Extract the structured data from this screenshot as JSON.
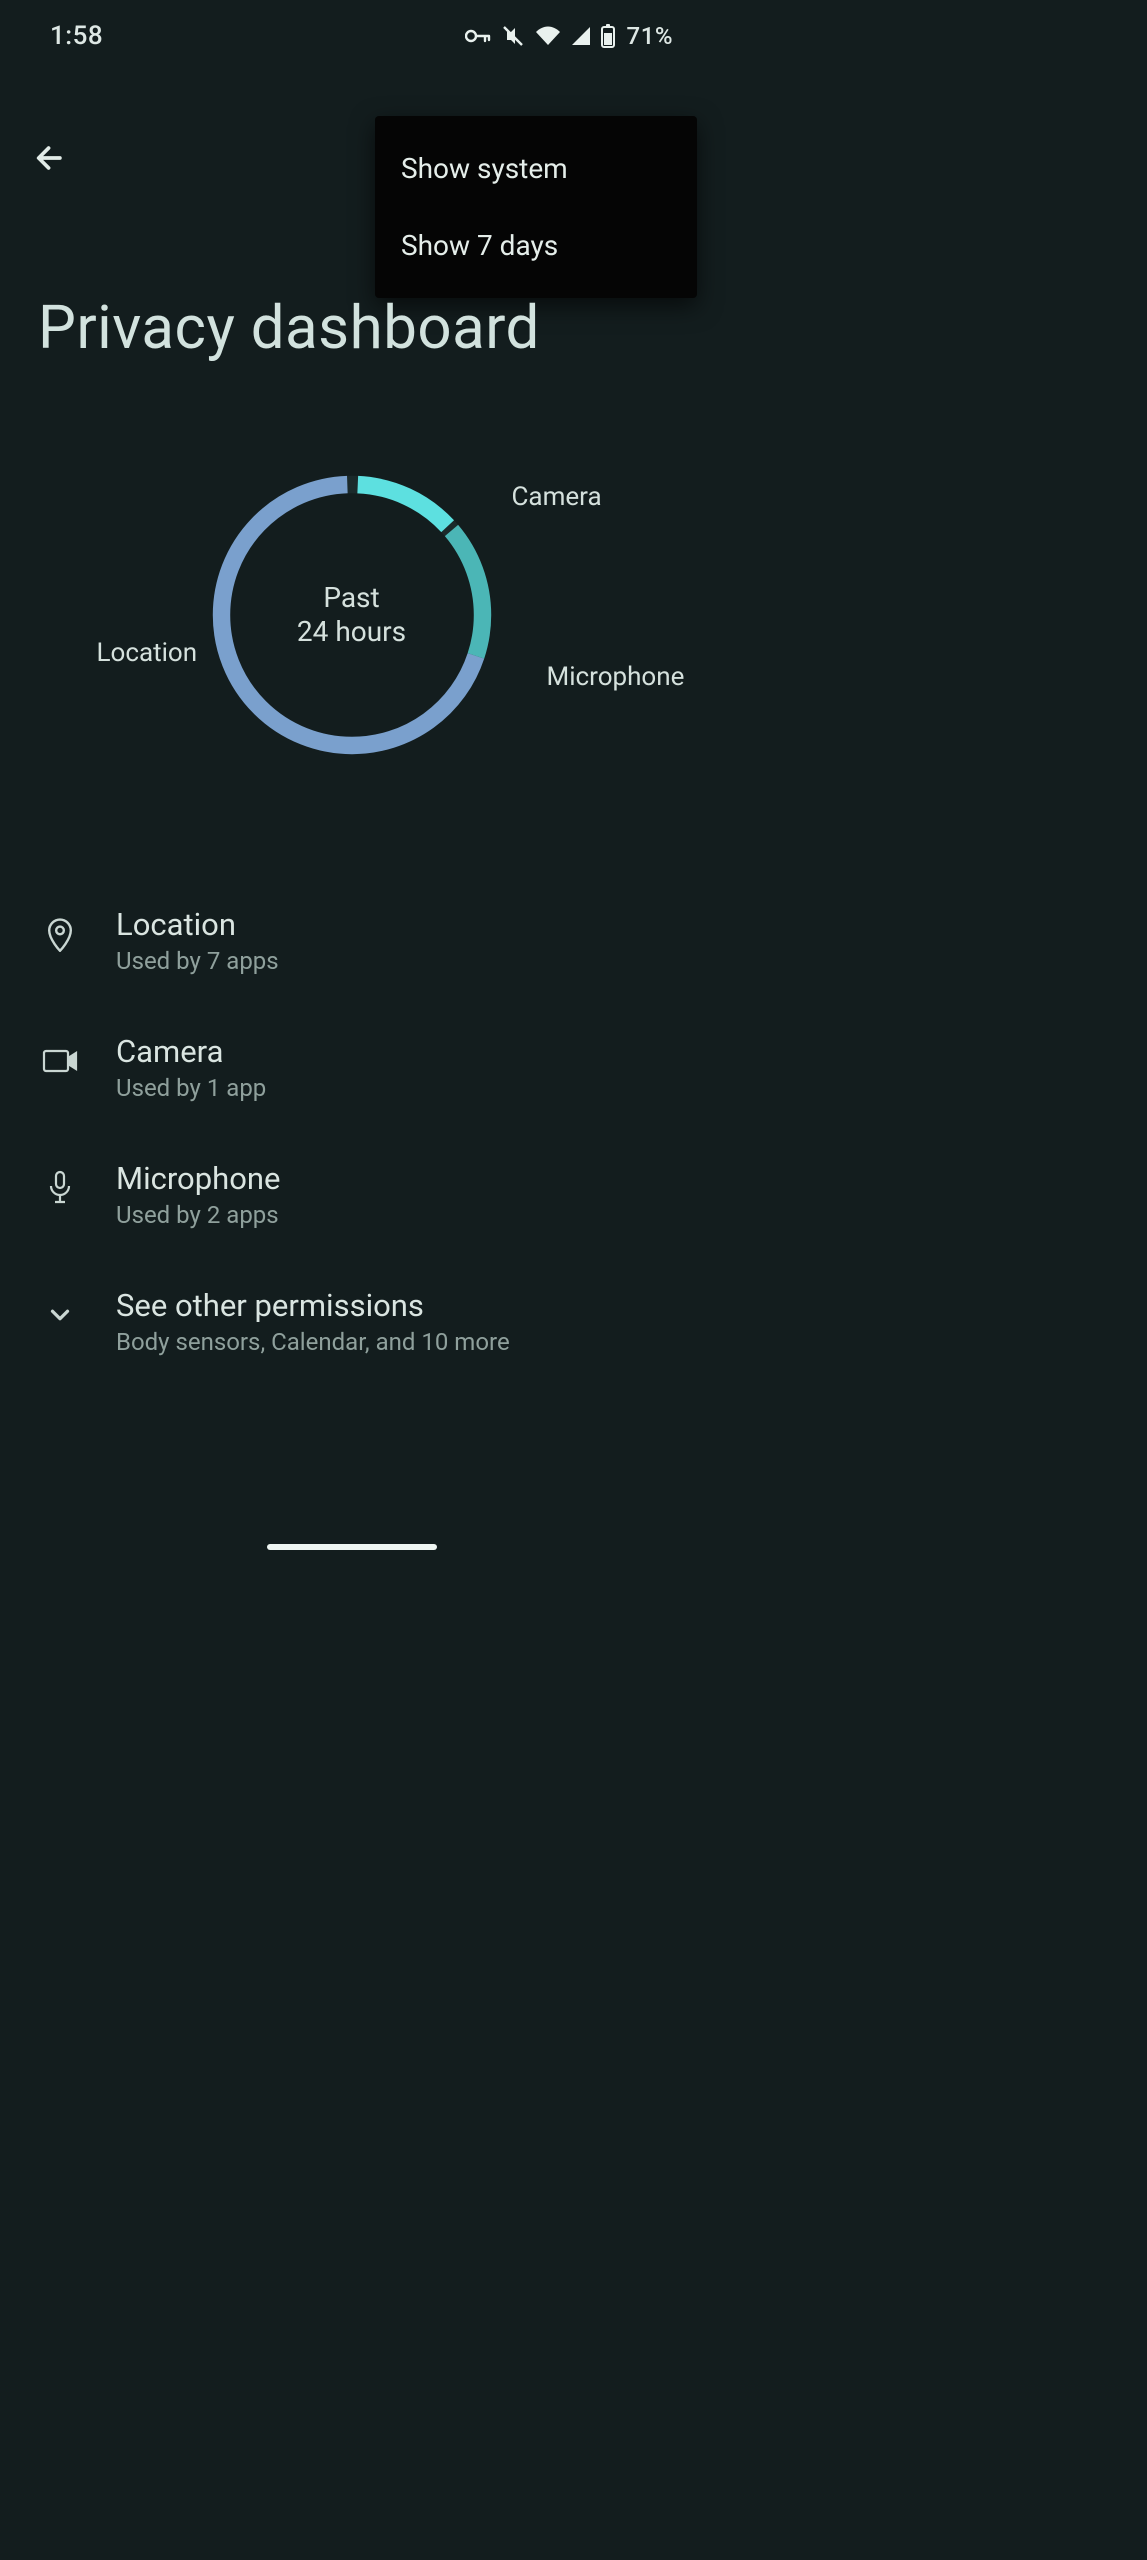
{
  "status": {
    "time": "1:58",
    "battery": "71%"
  },
  "menu": {
    "item1": "Show system",
    "item2": "Show 7 days"
  },
  "title": "Privacy dashboard",
  "chart": {
    "center1": "Past",
    "center2": "24 hours",
    "labels": {
      "camera": "Camera",
      "microphone": "Microphone",
      "location": "Location"
    }
  },
  "chart_data": {
    "type": "pie",
    "title": "Permission usage — Past 24 hours",
    "categories": [
      "Location",
      "Camera",
      "Microphone"
    ],
    "values": [
      70,
      13,
      17
    ],
    "colors": [
      "#7aa0cd",
      "#5de0e0",
      "#4bb6b6"
    ]
  },
  "rows": {
    "location": {
      "title": "Location",
      "sub": "Used by 7 apps"
    },
    "camera": {
      "title": "Camera",
      "sub": "Used by 1 app"
    },
    "microphone": {
      "title": "Microphone",
      "sub": "Used by 2 apps"
    },
    "other": {
      "title": "See other permissions",
      "sub": "Body sensors, Calendar, and 10 more"
    }
  }
}
